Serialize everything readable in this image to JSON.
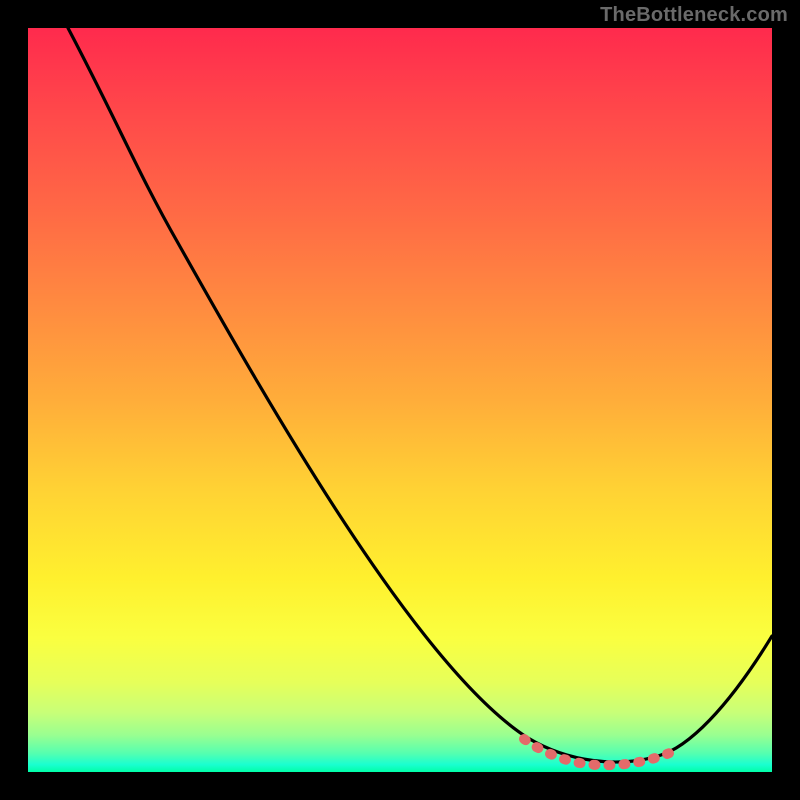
{
  "watermark": "TheBottleneck.com",
  "chart_data": {
    "type": "line",
    "title": "",
    "xlabel": "",
    "ylabel": "",
    "xlim": [
      0,
      100
    ],
    "ylim": [
      0,
      100
    ],
    "grid": false,
    "legend": false,
    "background": "vertical-heat-gradient",
    "series": [
      {
        "name": "bottleneck-curve",
        "color": "#000000",
        "x": [
          5,
          10,
          15,
          20,
          25,
          30,
          35,
          40,
          45,
          50,
          55,
          60,
          65,
          70,
          75,
          80,
          85,
          90,
          95,
          100
        ],
        "y": [
          100,
          92,
          85,
          77,
          69,
          61,
          53,
          45,
          37,
          30,
          23,
          17,
          11,
          6,
          3,
          1,
          1,
          4,
          10,
          18
        ]
      },
      {
        "name": "valley-highlight",
        "color": "#e46a6a",
        "style": "dotted",
        "x": [
          67,
          70,
          73,
          76,
          79,
          82,
          85,
          87
        ],
        "y": [
          4.5,
          3,
          2,
          1.3,
          1,
          1,
          1.5,
          2.8
        ]
      }
    ],
    "gradient_stops": [
      {
        "pos": 0.0,
        "color": "#ff2a4d"
      },
      {
        "pos": 0.12,
        "color": "#ff4a4a"
      },
      {
        "pos": 0.25,
        "color": "#ff6a45"
      },
      {
        "pos": 0.37,
        "color": "#ff8a40"
      },
      {
        "pos": 0.5,
        "color": "#ffad3a"
      },
      {
        "pos": 0.62,
        "color": "#ffd234"
      },
      {
        "pos": 0.74,
        "color": "#fff02e"
      },
      {
        "pos": 0.82,
        "color": "#faff40"
      },
      {
        "pos": 0.88,
        "color": "#e6ff5a"
      },
      {
        "pos": 0.92,
        "color": "#c8ff78"
      },
      {
        "pos": 0.95,
        "color": "#9aff90"
      },
      {
        "pos": 0.975,
        "color": "#55ffb0"
      },
      {
        "pos": 0.99,
        "color": "#1affd0"
      },
      {
        "pos": 1.0,
        "color": "#00ffa8"
      }
    ]
  }
}
